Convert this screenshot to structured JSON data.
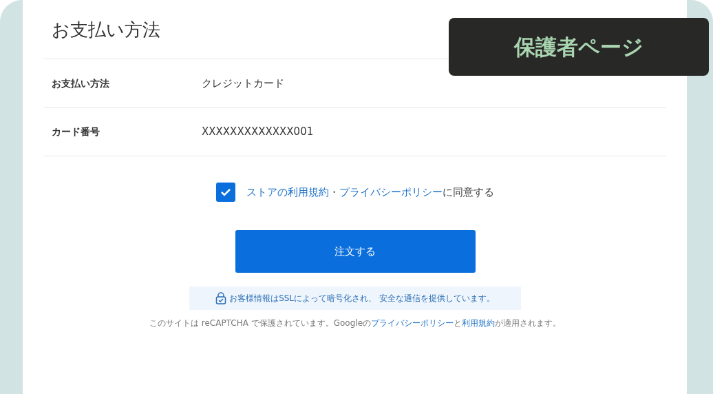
{
  "title": "お支払い方法",
  "badge": "保護者ページ",
  "details": [
    {
      "label": "お支払い方法",
      "value": "クレジットカード"
    },
    {
      "label": "カード番号",
      "value": "XXXXXXXXXXXXX001"
    }
  ],
  "consent": {
    "checked": true,
    "parts": [
      {
        "kind": "link",
        "text": "ストアの利用規約"
      },
      {
        "kind": "text",
        "text": "・"
      },
      {
        "kind": "link",
        "text": "プライバシーポリシー"
      },
      {
        "kind": "text",
        "text": "に同意する"
      }
    ]
  },
  "order_button": "注文する",
  "ssl_notice": "お客様情報はSSLによって暗号化され、 安全な通信を提供しています。",
  "recaptcha": [
    {
      "kind": "text",
      "text": "このサイトは reCAPTCHA で保護されています。Googleの"
    },
    {
      "kind": "link",
      "text": "プライバシーポリシー"
    },
    {
      "kind": "text",
      "text": "と"
    },
    {
      "kind": "link",
      "text": "利用規約"
    },
    {
      "kind": "text",
      "text": "が適用されます。"
    }
  ]
}
